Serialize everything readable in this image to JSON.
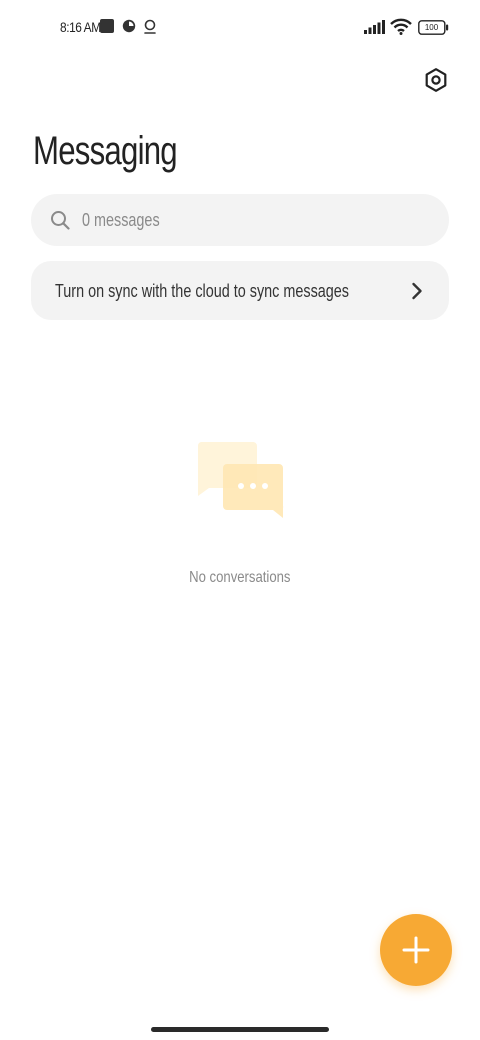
{
  "status_bar": {
    "time": "8:16 AM",
    "battery": "100",
    "icons": [
      "square-notification-icon",
      "pie-icon",
      "location-pin-icon",
      "signal-icon",
      "wifi-icon",
      "battery-icon"
    ]
  },
  "header": {
    "title": "Messaging",
    "settings_icon": "settings-icon"
  },
  "search": {
    "placeholder": "0 messages",
    "icon": "search-icon"
  },
  "sync_banner": {
    "label": "Turn on sync with the cloud to sync messages",
    "icon": "chevron-right-icon"
  },
  "empty_state": {
    "icon": "chat-bubbles-icon",
    "message": "No conversations"
  },
  "fab": {
    "icon": "plus-icon"
  },
  "colors": {
    "accent": "#f7a934",
    "surface": "#f3f3f3",
    "illustration_light": "#fff4da",
    "illustration_mid": "#ffe7b3"
  }
}
